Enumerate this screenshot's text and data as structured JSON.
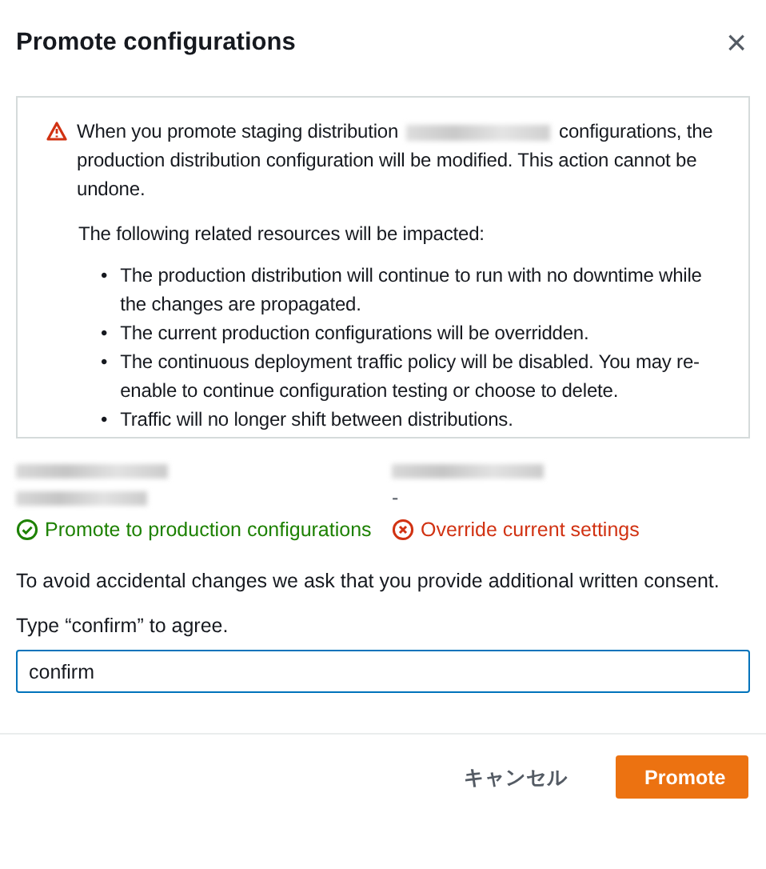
{
  "dialog": {
    "title": "Promote configurations",
    "close_icon": "×"
  },
  "warning": {
    "text_before": "When you promote staging distribution",
    "text_after": "configurations, the production distribution configuration will be modified. This action cannot be undone.",
    "impact_intro": "The following related resources will be impacted:",
    "impacts": [
      {
        "bullet": "•",
        "text": "The production distribution will continue to run with no downtime while the changes are propagated."
      },
      {
        "bullet": "•",
        "text": "The current production configurations will be overridden."
      },
      {
        "bullet": "•",
        "text": "The continuous deployment traffic policy will be disabled. You may re-enable to continue configuration testing or choose to delete."
      },
      {
        "bullet": "•",
        "text": "Traffic will no longer shift between distributions."
      }
    ]
  },
  "columns": [
    {
      "status": {
        "kind": "success",
        "text": "Promote to production configurations"
      }
    },
    {
      "value": "-",
      "status": {
        "kind": "error",
        "text": "Override current settings"
      }
    }
  ],
  "consent": {
    "text": "To avoid accidental changes we ask that you provide additional written consent.",
    "label": "Type “confirm” to agree.",
    "value": "confirm"
  },
  "buttons": [
    {
      "kind": "link",
      "label": "キャンセル"
    },
    {
      "kind": "primary",
      "label": "Promote"
    }
  ]
}
